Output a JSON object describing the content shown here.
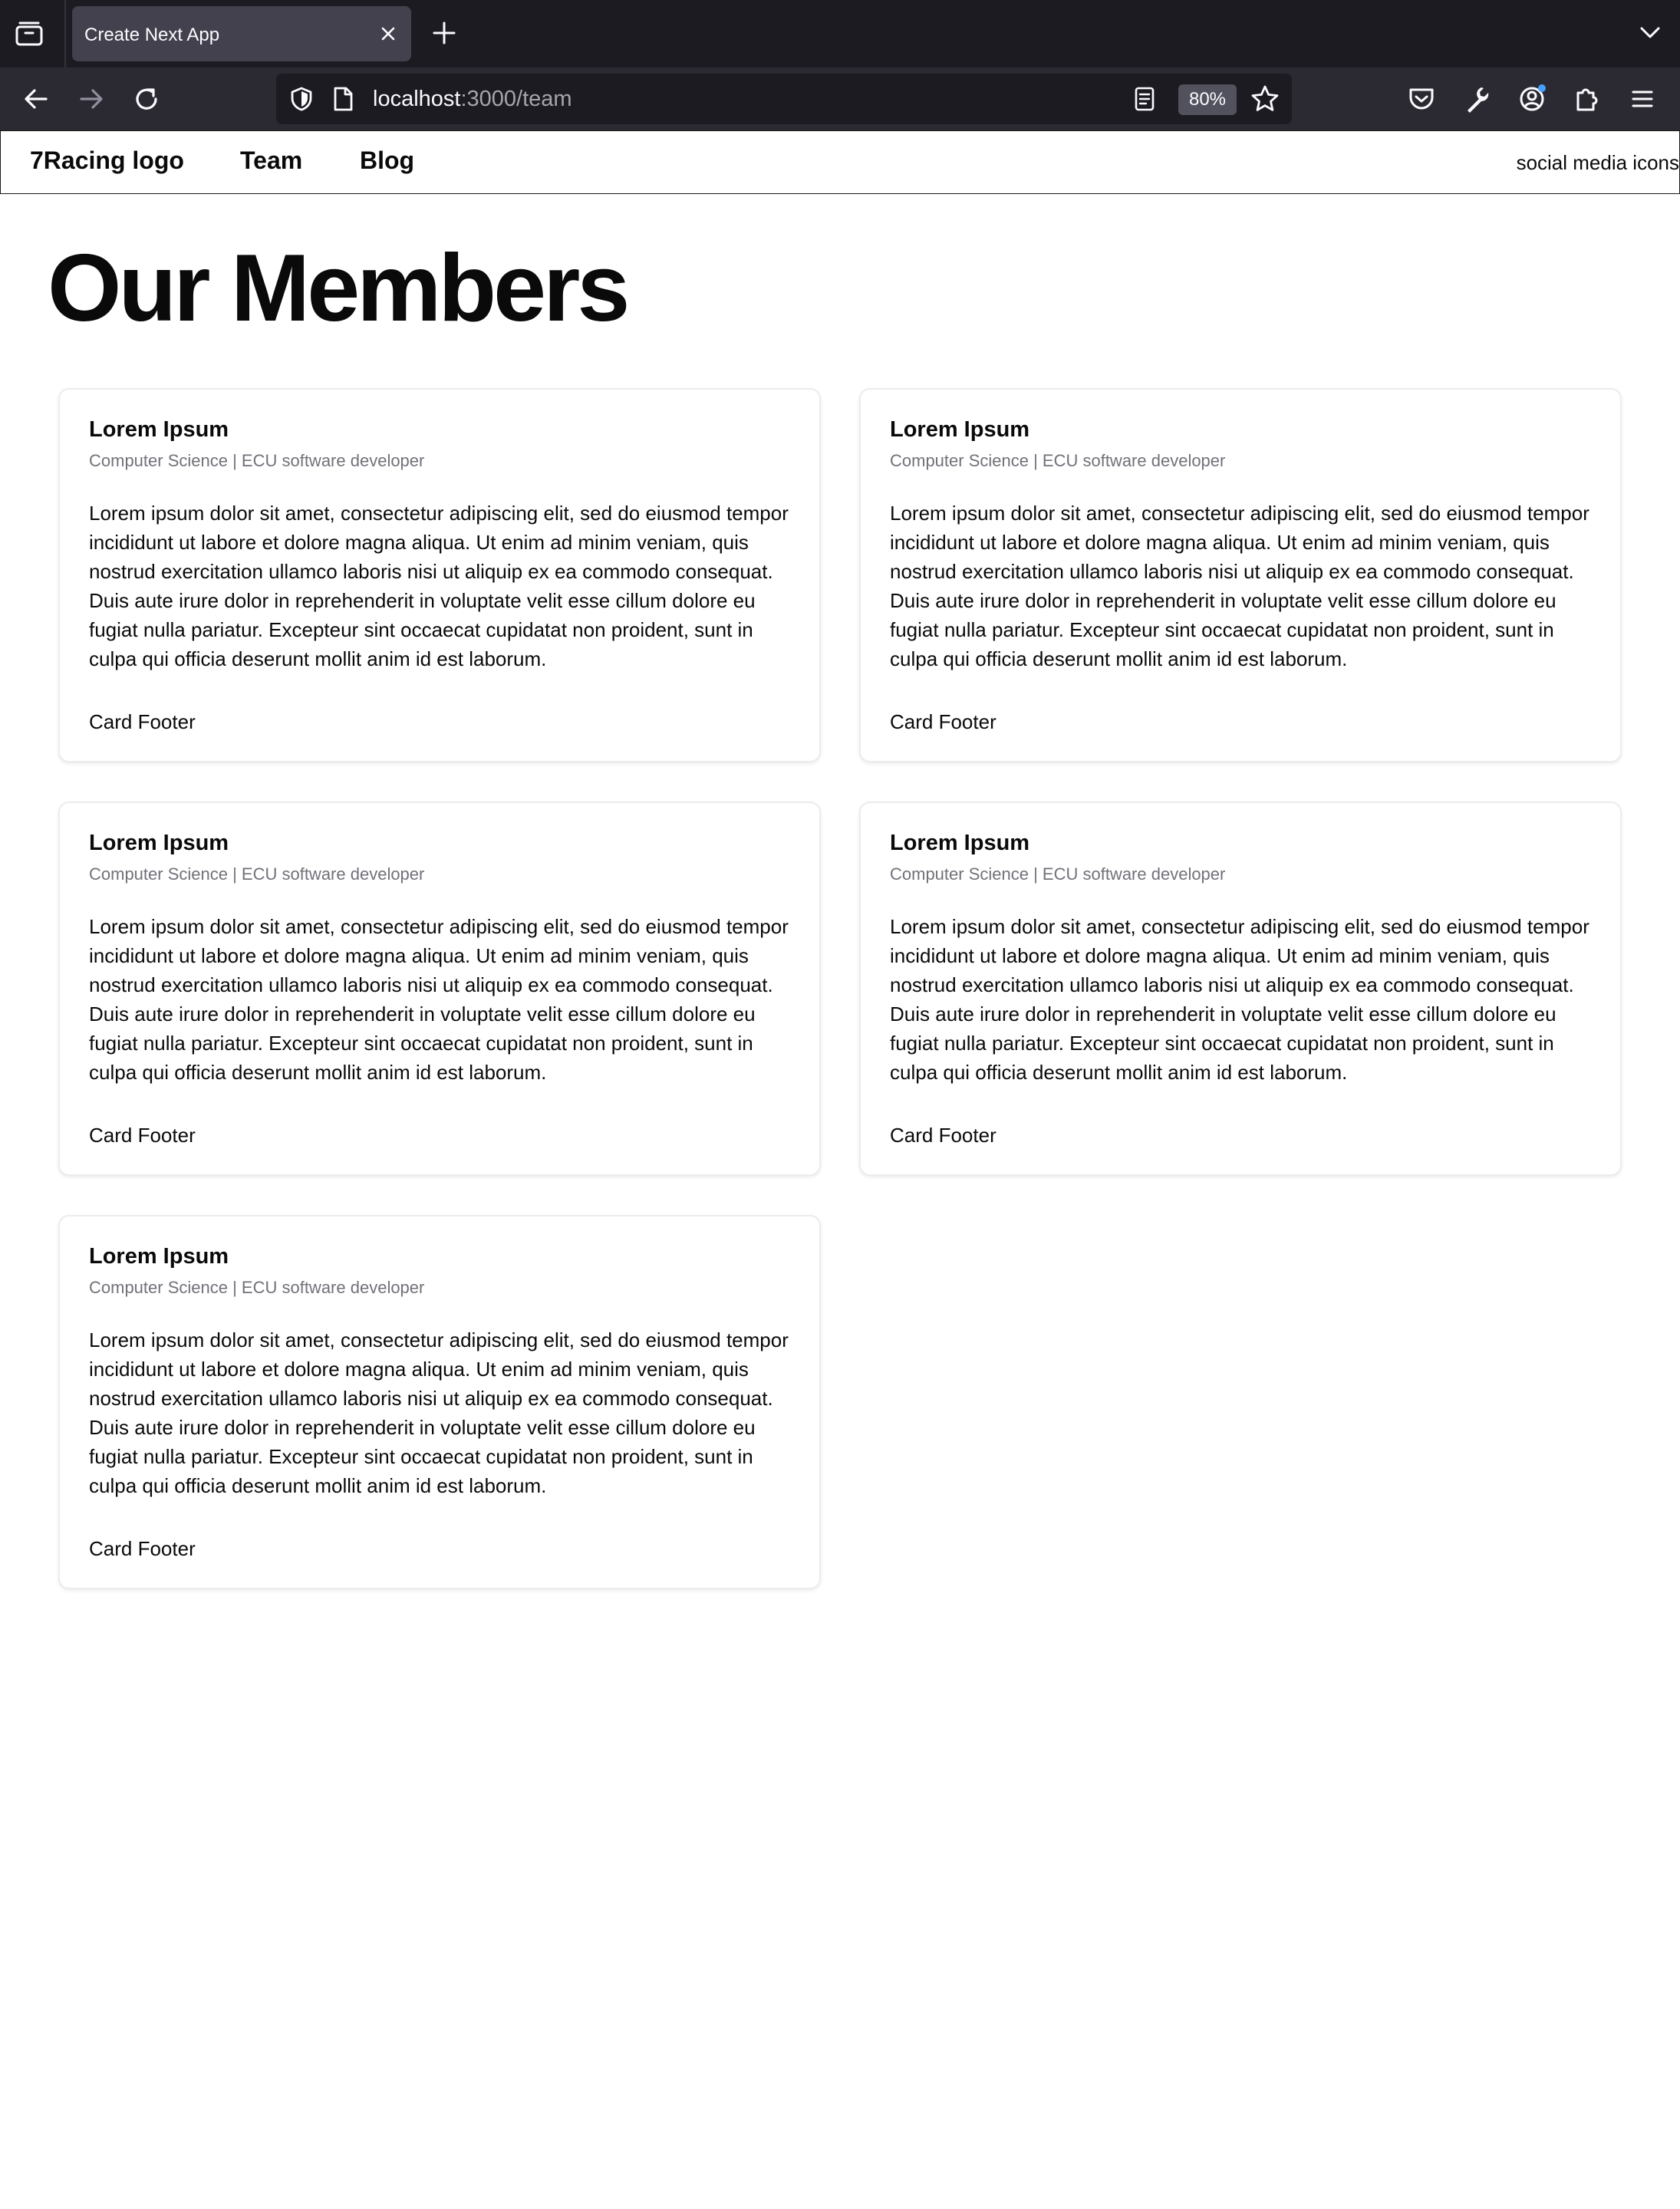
{
  "browser": {
    "tab_title": "Create Next App",
    "url_host": "localhost",
    "url_path": ":3000/team",
    "zoom": "80%"
  },
  "header": {
    "logo": "7Racing logo",
    "nav": [
      "Team",
      "Blog"
    ],
    "social": "social media icons"
  },
  "page": {
    "title": "Our Members"
  },
  "cards": [
    {
      "name": "Lorem Ipsum",
      "role": "Computer Science | ECU software developer",
      "body": "Lorem ipsum dolor sit amet, consectetur adipiscing elit, sed do eiusmod tempor incididunt ut labore et dolore magna aliqua. Ut enim ad minim veniam, quis nostrud exercitation ullamco laboris nisi ut aliquip ex ea commodo consequat. Duis aute irure dolor in reprehenderit in voluptate velit esse cillum dolore eu fugiat nulla pariatur. Excepteur sint occaecat cupidatat non proident, sunt in culpa qui officia deserunt mollit anim id est laborum.",
      "footer": "Card Footer"
    },
    {
      "name": "Lorem Ipsum",
      "role": "Computer Science | ECU software developer",
      "body": "Lorem ipsum dolor sit amet, consectetur adipiscing elit, sed do eiusmod tempor incididunt ut labore et dolore magna aliqua. Ut enim ad minim veniam, quis nostrud exercitation ullamco laboris nisi ut aliquip ex ea commodo consequat. Duis aute irure dolor in reprehenderit in voluptate velit esse cillum dolore eu fugiat nulla pariatur. Excepteur sint occaecat cupidatat non proident, sunt in culpa qui officia deserunt mollit anim id est laborum.",
      "footer": "Card Footer"
    },
    {
      "name": "Lorem Ipsum",
      "role": "Computer Science | ECU software developer",
      "body": "Lorem ipsum dolor sit amet, consectetur adipiscing elit, sed do eiusmod tempor incididunt ut labore et dolore magna aliqua. Ut enim ad minim veniam, quis nostrud exercitation ullamco laboris nisi ut aliquip ex ea commodo consequat. Duis aute irure dolor in reprehenderit in voluptate velit esse cillum dolore eu fugiat nulla pariatur. Excepteur sint occaecat cupidatat non proident, sunt in culpa qui officia deserunt mollit anim id est laborum.",
      "footer": "Card Footer"
    },
    {
      "name": "Lorem Ipsum",
      "role": "Computer Science | ECU software developer",
      "body": "Lorem ipsum dolor sit amet, consectetur adipiscing elit, sed do eiusmod tempor incididunt ut labore et dolore magna aliqua. Ut enim ad minim veniam, quis nostrud exercitation ullamco laboris nisi ut aliquip ex ea commodo consequat. Duis aute irure dolor in reprehenderit in voluptate velit esse cillum dolore eu fugiat nulla pariatur. Excepteur sint occaecat cupidatat non proident, sunt in culpa qui officia deserunt mollit anim id est laborum.",
      "footer": "Card Footer"
    },
    {
      "name": "Lorem Ipsum",
      "role": "Computer Science | ECU software developer",
      "body": "Lorem ipsum dolor sit amet, consectetur adipiscing elit, sed do eiusmod tempor incididunt ut labore et dolore magna aliqua. Ut enim ad minim veniam, quis nostrud exercitation ullamco laboris nisi ut aliquip ex ea commodo consequat. Duis aute irure dolor in reprehenderit in voluptate velit esse cillum dolore eu fugiat nulla pariatur. Excepteur sint occaecat cupidatat non proident, sunt in culpa qui officia deserunt mollit anim id est laborum.",
      "footer": "Card Footer"
    }
  ],
  "colors": {
    "chrome_dark": "#1c1b22",
    "chrome_toolbar": "#2b2a33",
    "tab_active": "#42414d",
    "text": "#0a0a0a",
    "muted": "#71717a",
    "card_border": "#ececef"
  }
}
